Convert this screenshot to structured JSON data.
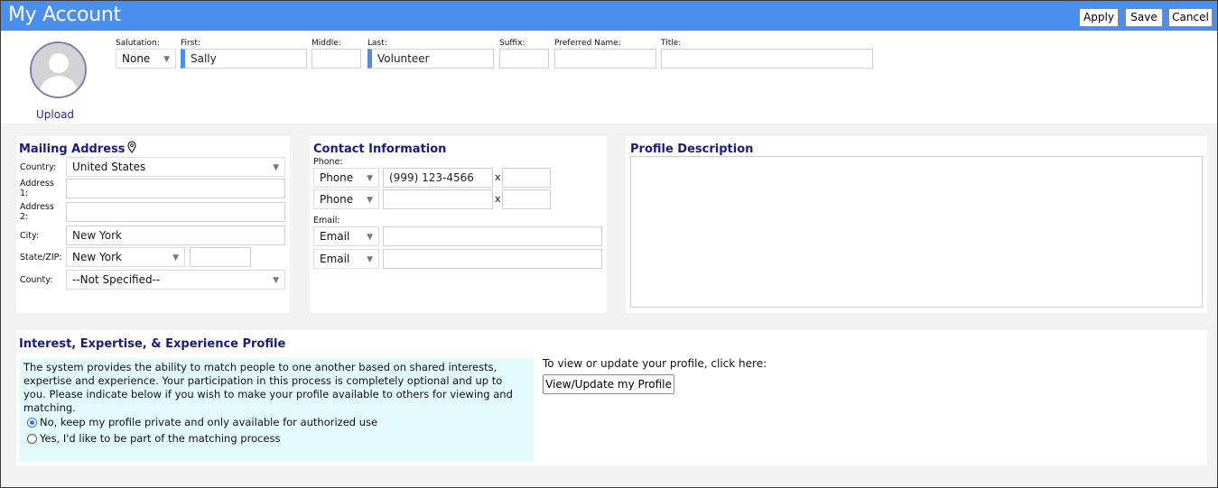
{
  "header": {
    "title": "My Account",
    "apply_label": "Apply",
    "save_label": "Save",
    "cancel_label": "Cancel"
  },
  "profile": {
    "upload_label": "Upload",
    "salutation": {
      "label": "Salutation:",
      "value": "None"
    },
    "first": {
      "label": "First:",
      "value": "Sally"
    },
    "middle": {
      "label": "Middle:",
      "value": ""
    },
    "last": {
      "label": "Last:",
      "value": "Volunteer"
    },
    "suffix": {
      "label": "Suffix:",
      "value": ""
    },
    "preferred_name": {
      "label": "Preferred Name:",
      "value": ""
    },
    "title": {
      "label": "Title:",
      "value": ""
    }
  },
  "mailing_address": {
    "heading": "Mailing Address",
    "country": {
      "label": "Country:",
      "value": "United States"
    },
    "address1": {
      "label": "Address 1:",
      "value": ""
    },
    "address2": {
      "label": "Address 2:",
      "value": ""
    },
    "city": {
      "label": "City:",
      "value": "New York"
    },
    "state_zip": {
      "label": "State/ZIP:",
      "state": "New York",
      "zip": ""
    },
    "county": {
      "label": "County:",
      "value": "--Not Specified--"
    }
  },
  "contact": {
    "heading": "Contact Information",
    "phone_label": "Phone:",
    "phones": [
      {
        "type": "Phone",
        "number": "(999) 123-4566",
        "ext_marker": "x",
        "ext": ""
      },
      {
        "type": "Phone",
        "number": "",
        "ext_marker": "x",
        "ext": ""
      }
    ],
    "email_label": "Email:",
    "emails": [
      {
        "type": "Email",
        "address": ""
      },
      {
        "type": "Email",
        "address": ""
      }
    ]
  },
  "profile_description": {
    "heading": "Profile Description",
    "value": ""
  },
  "interest": {
    "heading": "Interest, Expertise, & Experience Profile",
    "description": "The system provides the ability to match people to one another based on shared interests, expertise and experience. Your participation in this process is completely optional and up to you. Please indicate below if you wish to make your profile available to others for viewing and matching.",
    "options": [
      {
        "label": "No, keep my profile private and only available for authorized use",
        "selected": true
      },
      {
        "label": "Yes, I'd like to be part of the matching process",
        "selected": false
      }
    ],
    "view_prompt": "To view or update your profile, click here:",
    "view_button": "View/Update my Profile"
  },
  "colors": {
    "header_bg": "#4a8eee",
    "heading_text": "#1a1a80",
    "required_marker": "#4a8eee",
    "info_bg": "#e4fbfb"
  },
  "icons": {
    "location": "map-pin-icon",
    "avatar": "user-silhouette-icon",
    "dropdown": "caret-down-icon"
  }
}
